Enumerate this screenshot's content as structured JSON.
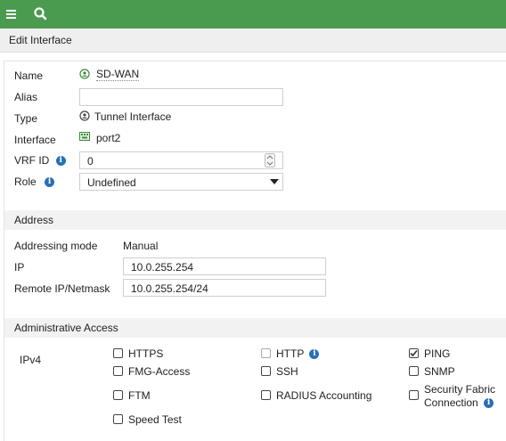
{
  "topbar": {
    "menu_icon": "hamburger-icon",
    "search_icon": "search-icon",
    "color": "#4a9b4f"
  },
  "title": "Edit Interface",
  "fields": {
    "name_label": "Name",
    "name_value": "SD-WAN",
    "alias_label": "Alias",
    "alias_value": "",
    "type_label": "Type",
    "type_value": "Tunnel Interface",
    "interface_label": "Interface",
    "interface_value": "port2",
    "vrf_label": "VRF ID",
    "vrf_value": "0",
    "role_label": "Role",
    "role_value": "Undefined"
  },
  "address": {
    "section_title": "Address",
    "mode_label": "Addressing mode",
    "mode_value": "Manual",
    "ip_label": "IP",
    "ip_value": "10.0.255.254",
    "remote_label": "Remote IP/Netmask",
    "remote_value": "10.0.255.254/24"
  },
  "admin": {
    "section_title": "Administrative Access",
    "ipv4_label": "IPv4",
    "options": [
      {
        "label": "HTTPS",
        "checked": false
      },
      {
        "label": "HTTP",
        "checked": false
      },
      {
        "label": "PING",
        "checked": true
      },
      {
        "label": "FMG-Access",
        "checked": false
      },
      {
        "label": "SSH",
        "checked": false
      },
      {
        "label": "SNMP",
        "checked": false
      },
      {
        "label": "FTM",
        "checked": false
      },
      {
        "label": "RADIUS Accounting",
        "checked": false
      },
      {
        "label": "Security Fabric",
        "label2": "Connection",
        "checked": false
      },
      {
        "label": "Speed Test",
        "checked": false
      }
    ]
  },
  "info_glyph": "i"
}
